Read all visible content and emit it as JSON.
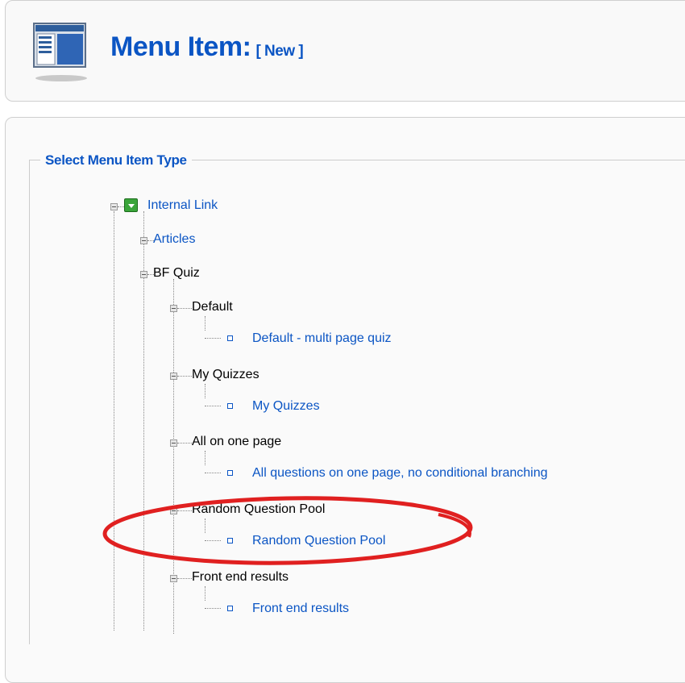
{
  "header": {
    "title": "Menu Item:",
    "subtitle": "[ New ]"
  },
  "fieldset": {
    "legend": "Select Menu Item Type"
  },
  "tree": {
    "internal_link": "Internal Link",
    "articles": "Articles",
    "bf_quiz": "BF Quiz",
    "default_group": "Default",
    "default_item": "Default - multi page quiz",
    "my_quizzes_group": "My Quizzes",
    "my_quizzes_item": "My Quizzes",
    "all_on_one_group": "All on one page",
    "all_on_one_item": "All questions on one page, no conditional branching",
    "random_pool_group": "Random Question Pool",
    "random_pool_item": "Random Question Pool",
    "front_end_group": "Front end results",
    "front_end_item": "Front end results"
  },
  "colors": {
    "link": "#0b55c4",
    "highlight_ellipse": "#e02020"
  },
  "icons": {
    "header": "menu-manager-icon",
    "internal_link": "green-expand-icon",
    "toggle": "collapse-toggle-icon",
    "leaf": "leaf-square-icon"
  }
}
